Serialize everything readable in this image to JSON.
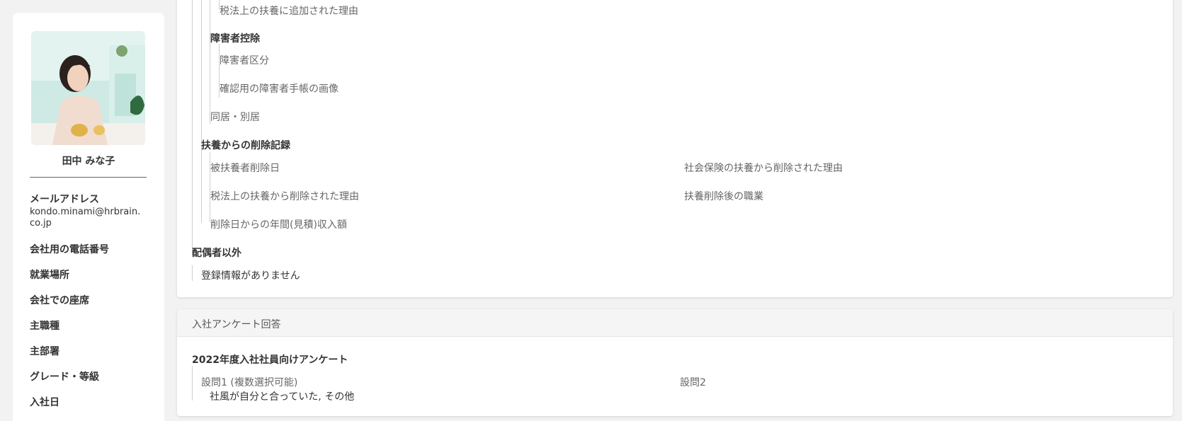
{
  "profile": {
    "name": "田中 みな子",
    "fields": [
      {
        "label": "メールアドレス",
        "value": "kondo.minami@hrbrain.co.jp"
      },
      {
        "label": "会社用の電話番号"
      },
      {
        "label": "就業場所"
      },
      {
        "label": "会社での座席"
      },
      {
        "label": "主職種"
      },
      {
        "label": "主部署"
      },
      {
        "label": "グレード・等級"
      },
      {
        "label": "入社日"
      }
    ]
  },
  "dependents": {
    "tax_added_reason": "税法上の扶養に追加された理由",
    "disability": {
      "title": "障害者控除",
      "category": "障害者区分",
      "certificate_image": "確認用の障害者手帳の画像"
    },
    "cohabitation": "同居・別居",
    "removal": {
      "title": "扶養からの削除記録",
      "removal_date": "被扶養者削除日",
      "social_insurance_reason": "社会保険の扶養から削除された理由",
      "tax_reason": "税法上の扶養から削除された理由",
      "occupation_after": "扶養削除後の職業",
      "annual_income": "削除日からの年間(見積)収入額"
    },
    "non_spouse": {
      "title": "配偶者以外",
      "empty_text": "登録情報がありません"
    }
  },
  "survey": {
    "header": "入社アンケート回答",
    "title": "2022年度入社社員向けアンケート",
    "q1_label": "設問1 (複数選択可能)",
    "q1_answer": "社風が自分と合っていた, その他",
    "q2_label": "設問2"
  }
}
